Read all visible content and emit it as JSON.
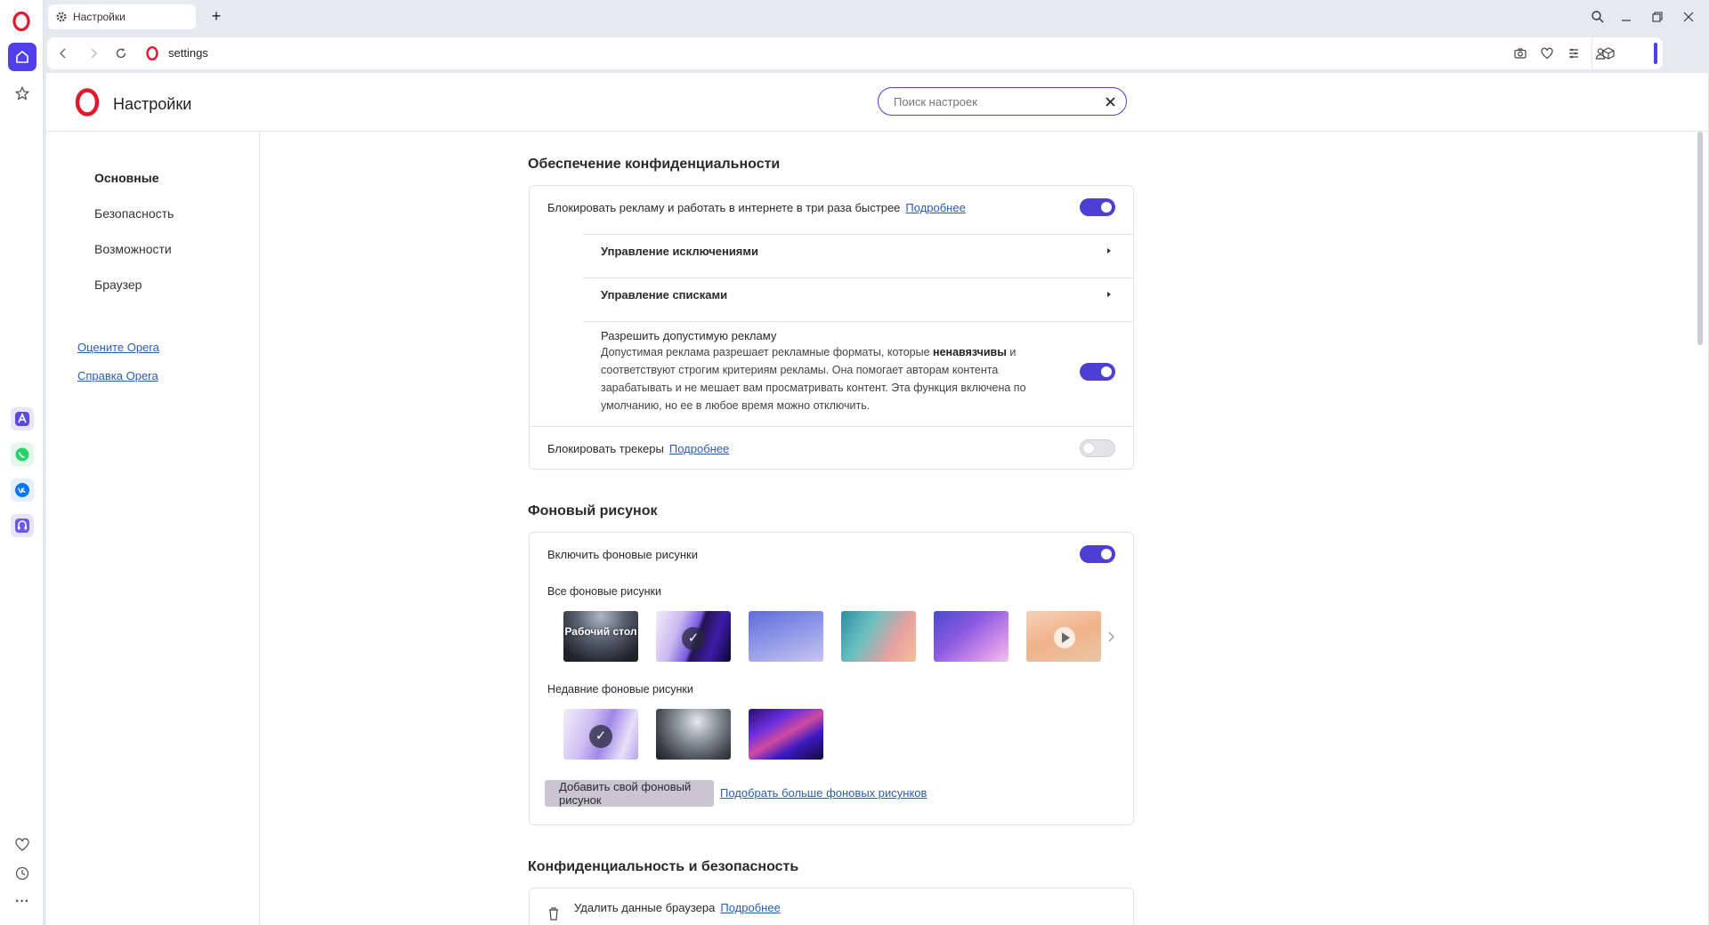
{
  "browser": {
    "tab_title": "Настройки",
    "new_tab_symbol": "+",
    "url": "settings",
    "accent_color": "#5040e9"
  },
  "sidebar": {
    "icons": [
      "opera-logo-icon",
      "home-icon",
      "star-icon",
      "aria-icon",
      "whatsapp-icon",
      "vk-icon",
      "music-icon",
      "heart-icon",
      "history-icon",
      "more-icon"
    ],
    "more_label": "···"
  },
  "header": {
    "title": "Настройки",
    "search_placeholder": "Поиск настроек"
  },
  "leftnav": {
    "items": [
      "Основные",
      "Безопасность",
      "Возможности",
      "Браузер"
    ],
    "links": [
      "Оцените Opera",
      "Справка Opera"
    ]
  },
  "privacy_section": {
    "title": "Обеспечение конфиденциальности",
    "block_ads_label": "Блокировать рекламу и работать в интернете в три раза быстрее",
    "block_ads_link": "Подробнее",
    "block_ads_on": true,
    "manage_exceptions": "Управление исключениями",
    "manage_lists": "Управление списками",
    "acceptable_ads_title": "Разрешить допустимую рекламу",
    "acceptable_ads_desc_1": "Допустимая реклама разрешает рекламные форматы, которые ",
    "acceptable_ads_desc_bold": "ненавязчивы",
    "acceptable_ads_desc_2": " и соответствуют строгим критериям рекламы. Она помогает авторам контента зарабатывать и не мешает вам просматривать контент. Эта функция включена по умолчанию, но ее в любое время можно отключить.",
    "acceptable_ads_on": true,
    "block_trackers_label": "Блокировать трекеры",
    "block_trackers_link": "Подробнее",
    "block_trackers_on": false
  },
  "wallpaper_section": {
    "title": "Фоновый рисунок",
    "enable_label": "Включить фоновые рисунки",
    "enable_on": true,
    "all_label": "Все фоновые рисунки",
    "desktop_thumb_label": "Рабочий стол",
    "recent_label": "Недавние фоновые рисунки",
    "add_button": "Добавить свой фоновый рисунок",
    "more_link": "Подобрать больше фоновых рисунков"
  },
  "security_section": {
    "title": "Конфиденциальность и безопасность",
    "clear_data_label": "Удалить данные браузера",
    "clear_data_link": "Подробнее"
  }
}
